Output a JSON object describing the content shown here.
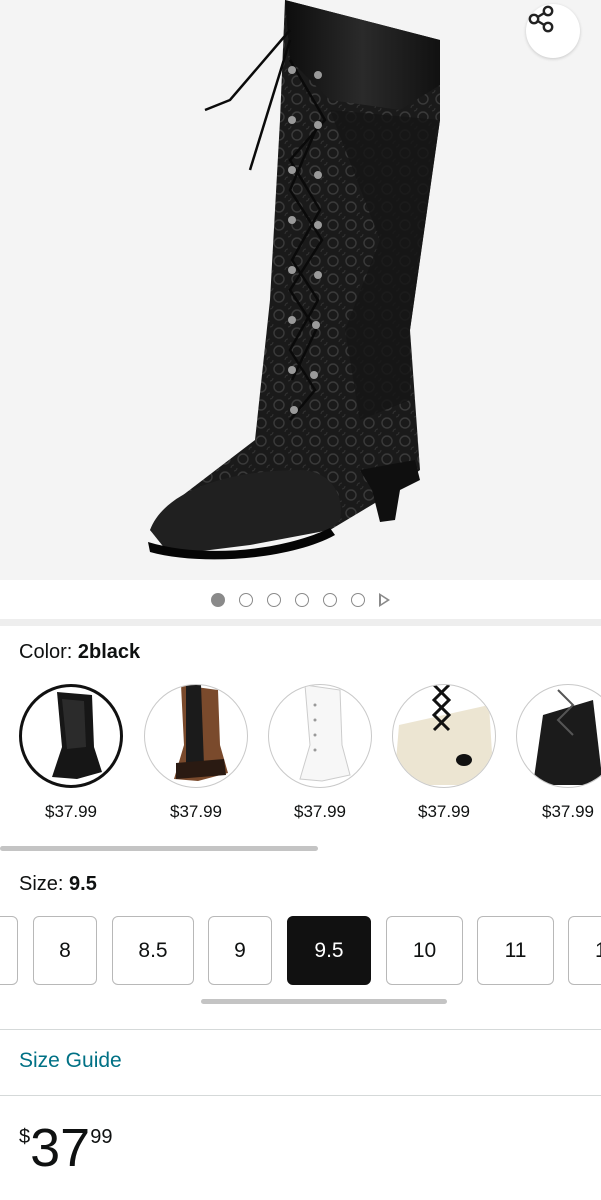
{
  "product": {
    "image_alt": "black lace-up knee high boot",
    "carousel": {
      "dot_count": 6,
      "active_index": 0,
      "has_video": true
    }
  },
  "share": {
    "icon": "share-icon"
  },
  "color": {
    "label": "Color: ",
    "selected": "2black",
    "options": [
      {
        "name": "2black",
        "price": "$37.99",
        "tone": "#161616",
        "selected": true
      },
      {
        "name": "brown",
        "price": "$37.99",
        "tone": "#7a4a2c",
        "selected": false
      },
      {
        "name": "white",
        "price": "$37.99",
        "tone": "#f2f2f2",
        "selected": false
      },
      {
        "name": "beige",
        "price": "$37.99",
        "tone": "#e9e2cf",
        "selected": false
      },
      {
        "name": "black",
        "price": "$37.99",
        "tone": "#1b1b1b",
        "selected": false
      }
    ]
  },
  "size": {
    "label": "Size: ",
    "selected": "9.5",
    "options": [
      "",
      "8",
      "8.5",
      "9",
      "9.5",
      "10",
      "11",
      "1"
    ]
  },
  "size_guide": {
    "label": "Size Guide"
  },
  "price": {
    "currency": "$",
    "whole": "37",
    "fraction": "99"
  },
  "colors": {
    "link": "#007185",
    "selected_bg": "#111111",
    "divider": "#d5d9d9"
  }
}
